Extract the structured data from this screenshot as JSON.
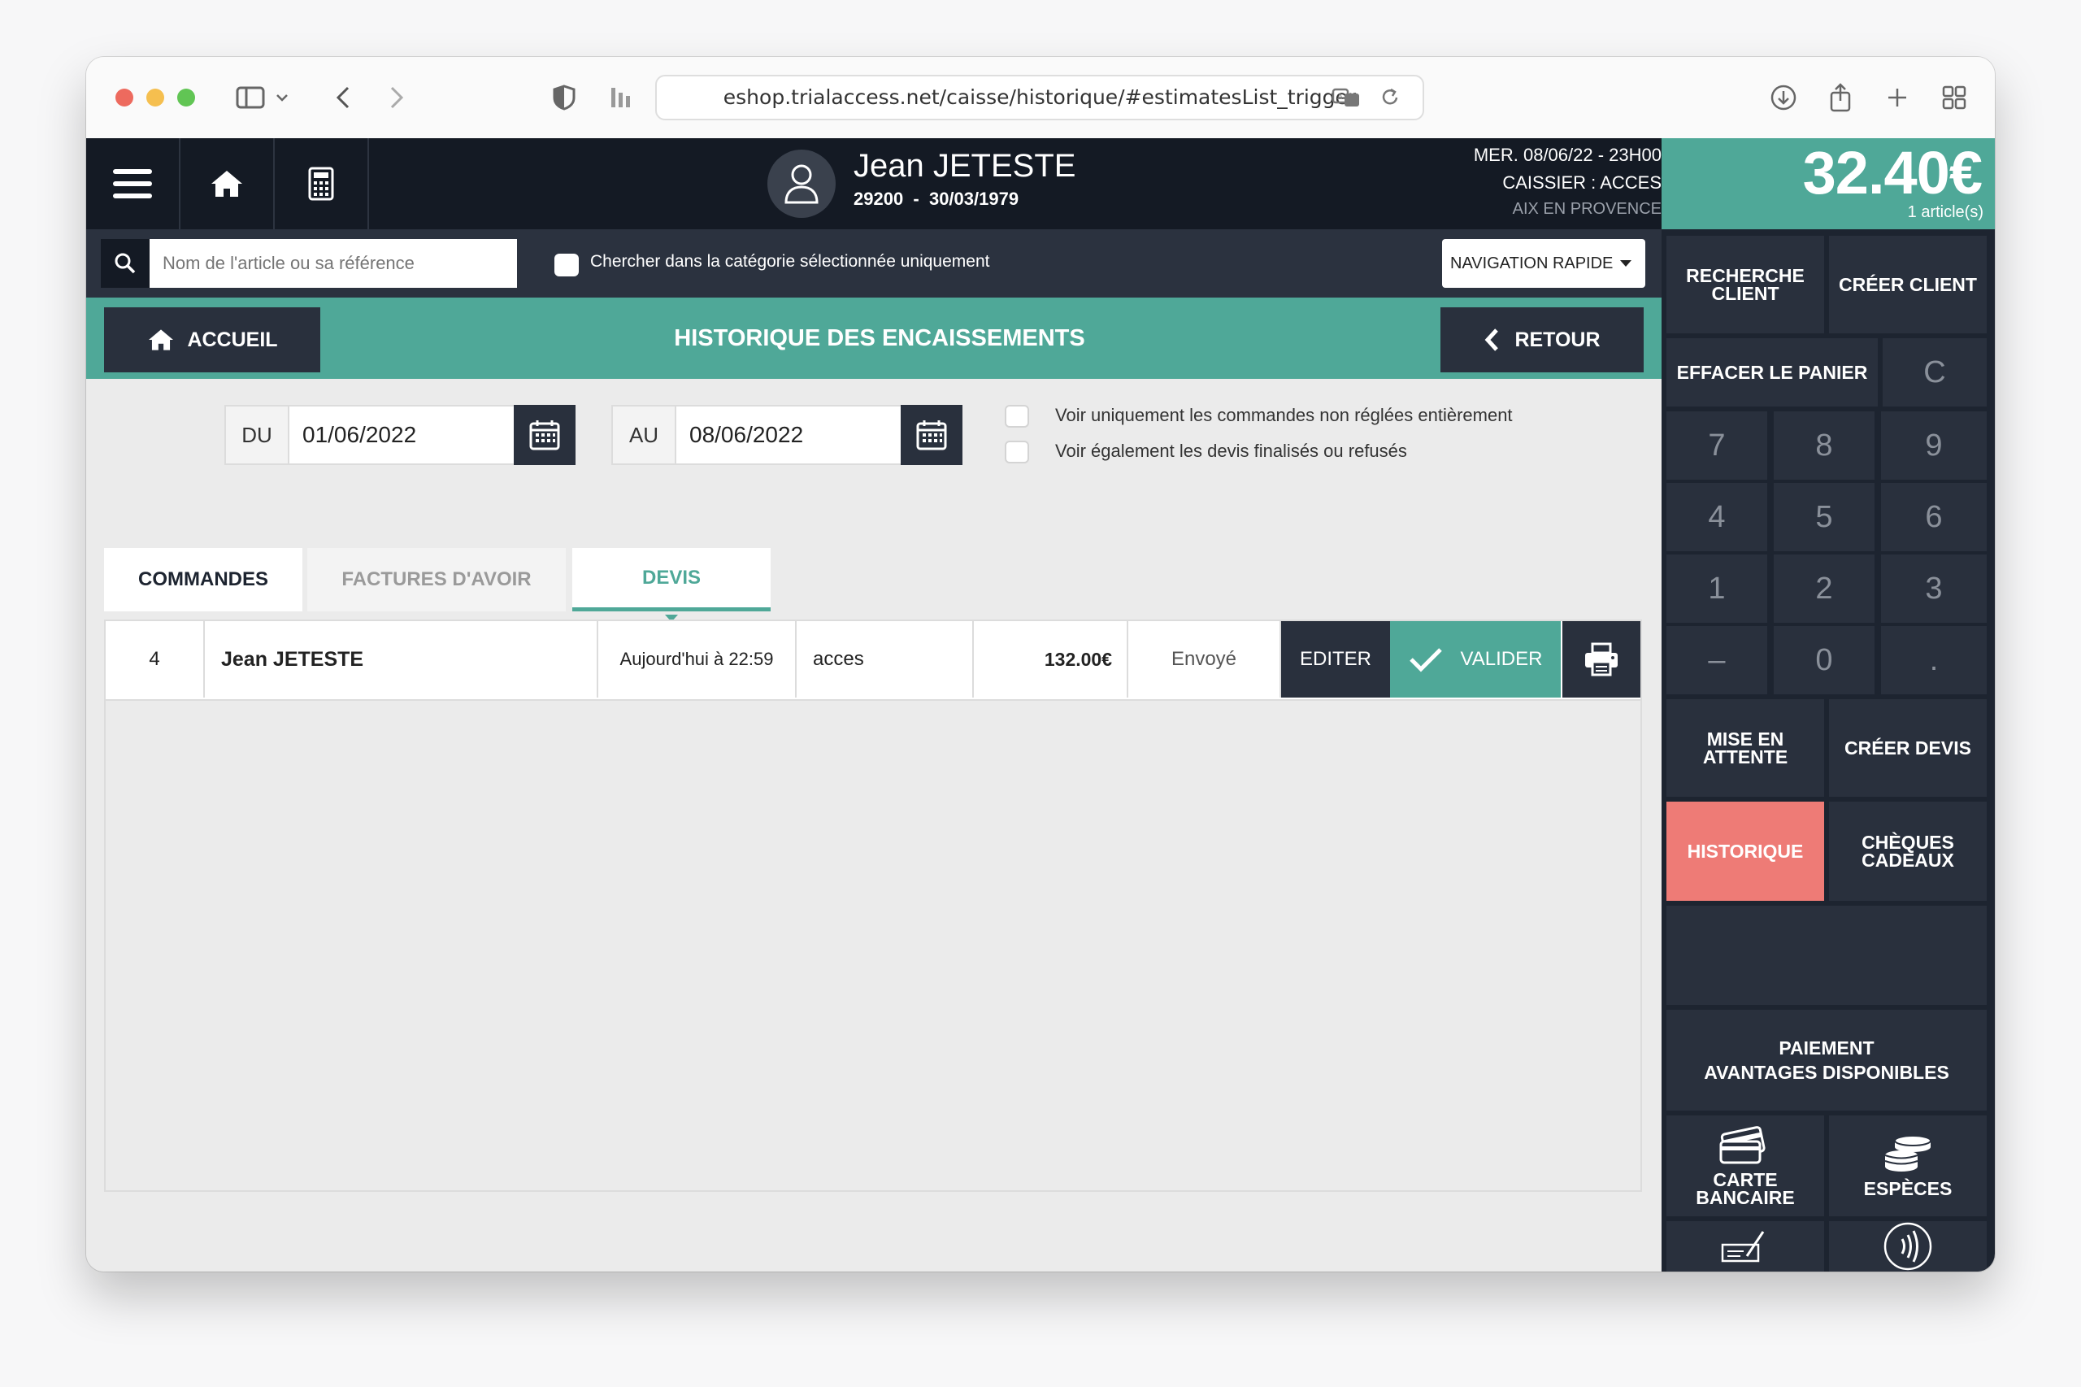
{
  "browser": {
    "url": "eshop.trialaccess.net/caisse/historique/#estimatesList_trigger",
    "icons": [
      "sidebar-icon",
      "chevron-down-icon",
      "back-icon",
      "forward-icon",
      "shield-icon",
      "extension-icon",
      "translate-icon",
      "reload-icon",
      "download-icon",
      "share-icon",
      "new-tab-icon",
      "tab-overview-icon"
    ]
  },
  "header": {
    "customer_name": "Jean JETESTE",
    "customer_info": "29200  -  30/03/1979",
    "date_line": "MER. 08/06/22 - 23H00",
    "cashier_line": "CAISSIER : ACCES",
    "store_line": "AIX EN PROVENCE"
  },
  "search": {
    "placeholder": "Nom de l'article ou sa référence",
    "category_checkbox_label": "Chercher dans la catégorie sélectionnée uniquement",
    "quick_nav_label": "NAVIGATION RAPIDE"
  },
  "nav": {
    "home_label": "ACCUEIL",
    "page_title": "HISTORIQUE DES ENCAISSEMENTS",
    "back_label": "RETOUR"
  },
  "filters": {
    "from_label": "DU",
    "from_value": "01/06/2022",
    "to_label": "AU",
    "to_value": "08/06/2022",
    "unpaid_only_label": "Voir uniquement les commandes non réglées entièrement",
    "include_finalized_label": "Voir également les devis finalisés ou refusés"
  },
  "tabs": [
    {
      "label": "COMMANDES"
    },
    {
      "label": "FACTURES D'AVOIR"
    },
    {
      "label": "DEVIS",
      "active": true
    }
  ],
  "rows": [
    {
      "id": "4",
      "customer": "Jean JETESTE",
      "date": "Aujourd'hui à 22:59",
      "user": "acces",
      "amount": "132.00€",
      "status": "Envoyé",
      "edit_label": "EDITER",
      "validate_label": "VALIDER"
    }
  ],
  "sidebar": {
    "total": "32.40€",
    "article_count": "1 article(s)",
    "search_client": "RECHERCHE CLIENT",
    "create_client": "CRÉER CLIENT",
    "clear_cart": "EFFACER LE PANIER",
    "clear_key": "C",
    "keys": [
      "7",
      "8",
      "9",
      "4",
      "5",
      "6",
      "1",
      "2",
      "3",
      "–",
      "0",
      "."
    ],
    "hold": "MISE EN ATTENTE",
    "create_quote": "CRÉER DEVIS",
    "history": "HISTORIQUE",
    "gift_cards": "CHÈQUES CADEAUX",
    "payment_advantages_line1": "PAIEMENT",
    "payment_advantages_line2": "AVANTAGES DISPONIBLES",
    "card": "CARTE BANCAIRE",
    "cash": "ESPÈCES"
  },
  "colors": {
    "accent": "#4fa898",
    "dark": "#141a24",
    "panel": "#29303d",
    "history_active": "#ee7b76"
  }
}
